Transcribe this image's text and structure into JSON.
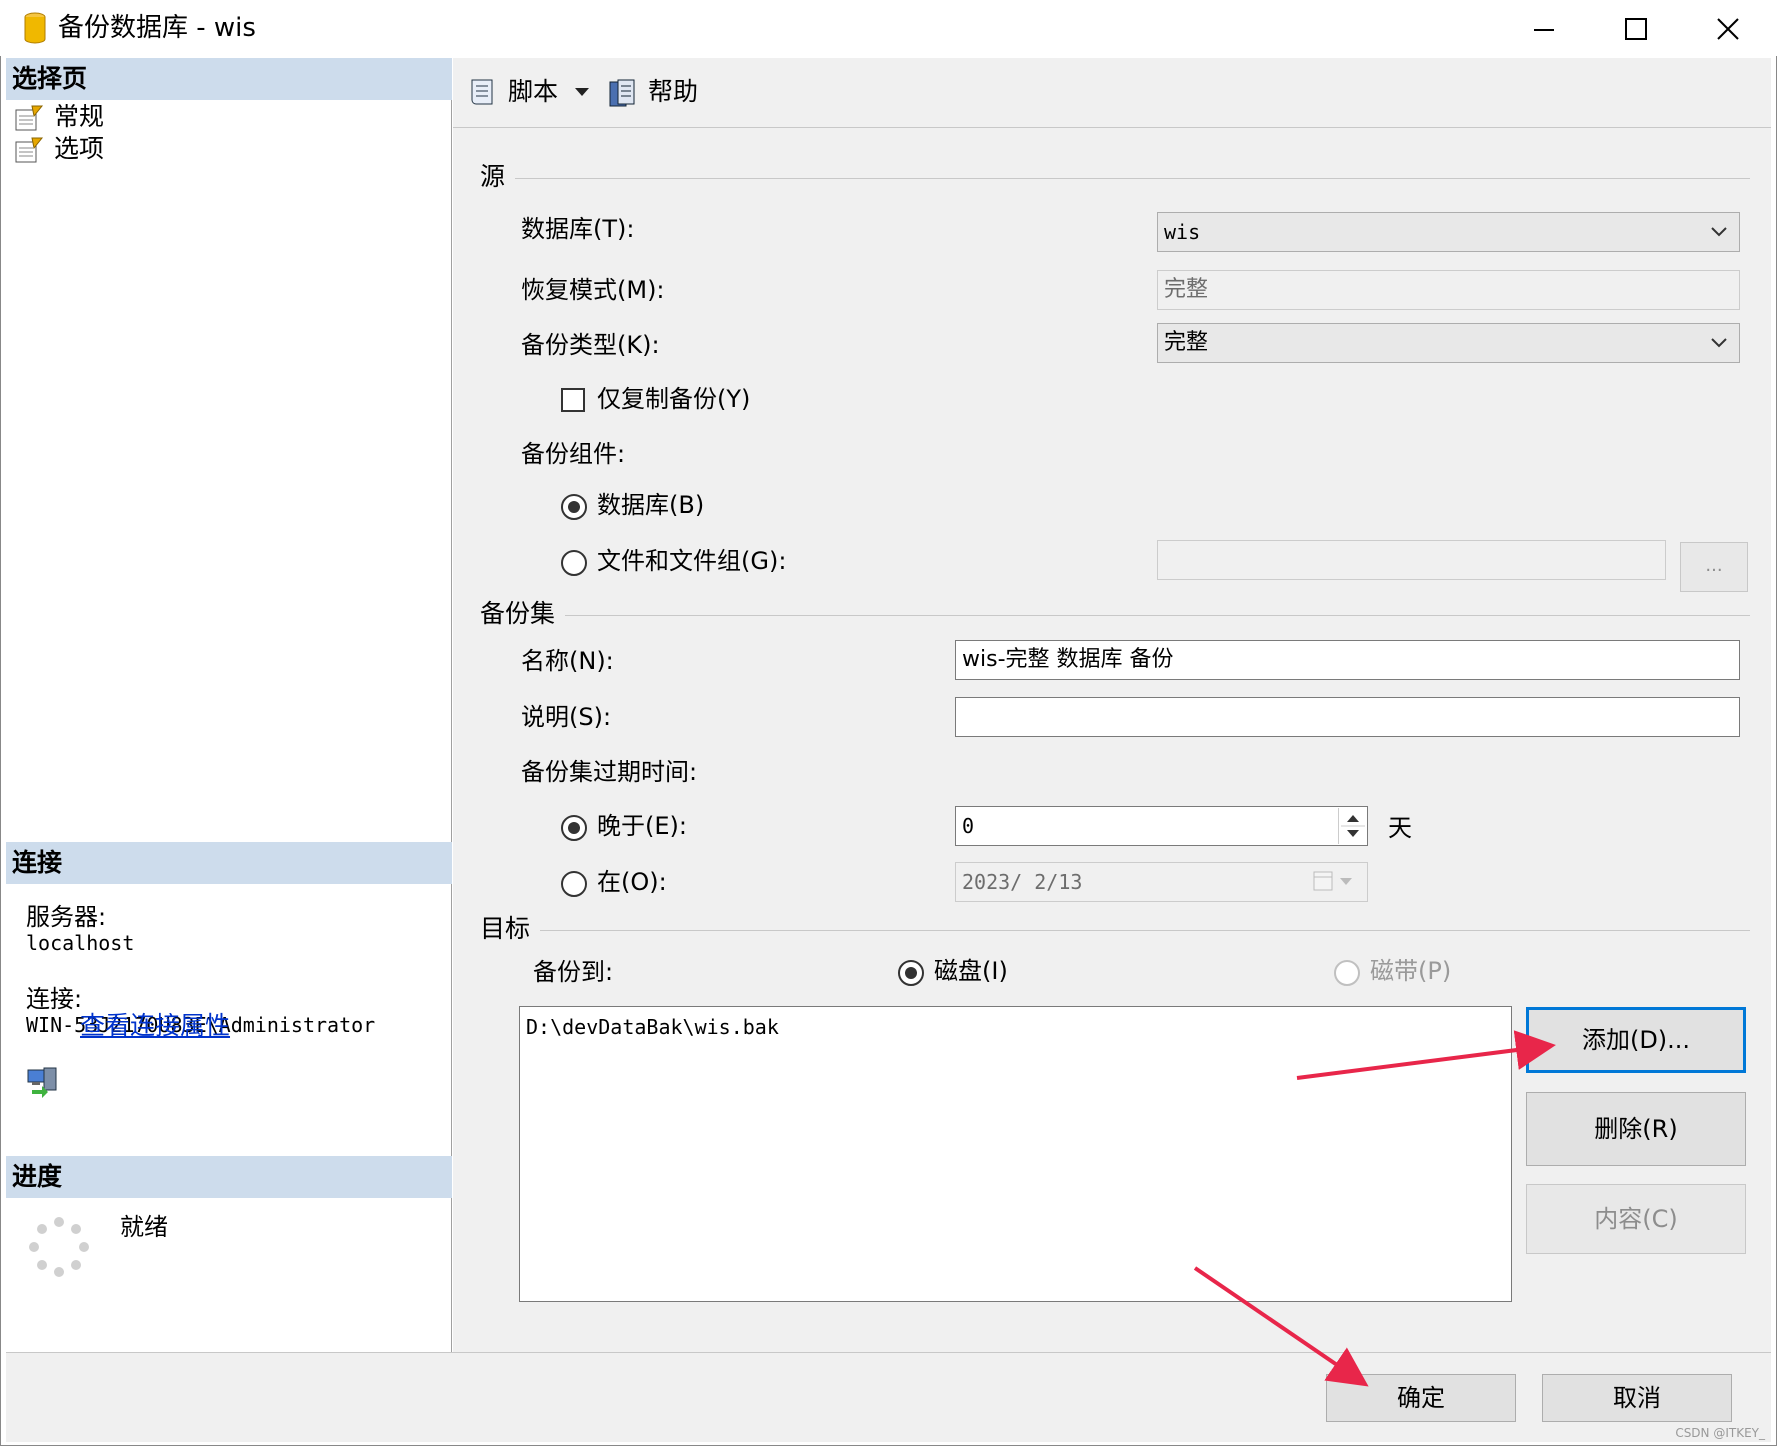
{
  "window": {
    "title": "备份数据库 - wis"
  },
  "left": {
    "select_page_header": "选择页",
    "pages": [
      {
        "label": "常规",
        "icon": "page-settings-icon"
      },
      {
        "label": "选项",
        "icon": "page-settings-icon"
      }
    ],
    "connection_header": "连接",
    "server_label": "服务器:",
    "server_value": "localhost",
    "connection_label": "连接:",
    "connection_value": "WIN-53J2170U83E\\Administrator",
    "view_connection_link": "查看连接属性",
    "progress_header": "进度",
    "progress_status": "就绪"
  },
  "toolbar": {
    "script_label": "脚本",
    "help_label": "帮助"
  },
  "source": {
    "group_label": "源",
    "database_label": "数据库(T):",
    "database_value": "wis",
    "recovery_label": "恢复模式(M):",
    "recovery_value": "完整",
    "backup_type_label": "备份类型(K):",
    "backup_type_value": "完整",
    "copy_only_label": "仅复制备份(Y)",
    "copy_only_checked": false,
    "component_label": "备份组件:",
    "component_database_label": "数据库(B)",
    "component_files_label": "文件和文件组(G):",
    "component_selected": "database",
    "files_value": "",
    "browse_label": "..."
  },
  "backup_set": {
    "group_label": "备份集",
    "name_label": "名称(N):",
    "name_value": "wis-完整 数据库 备份",
    "description_label": "说明(S):",
    "description_value": "",
    "expire_label": "备份集过期时间:",
    "after_label": "晚于(E):",
    "after_value": "0",
    "after_unit": "天",
    "on_label": "在(O):",
    "on_value": "2023/ 2/13",
    "expire_selected": "after"
  },
  "destination": {
    "group_label": "目标",
    "backup_to_label": "备份到:",
    "disk_label": "磁盘(I)",
    "tape_label": "磁带(P)",
    "selected": "disk",
    "files": [
      "D:\\devDataBak\\wis.bak"
    ],
    "add_label": "添加(D)...",
    "remove_label": "删除(R)",
    "contents_label": "内容(C)"
  },
  "footer": {
    "ok_label": "确定",
    "cancel_label": "取消",
    "watermark": "CSDN @ITKEY_"
  },
  "colors": {
    "section_header_bg": "#cddcec",
    "focus_border": "#0078d7",
    "annotation_arrow": "#e8264a",
    "link": "#0033cc"
  }
}
